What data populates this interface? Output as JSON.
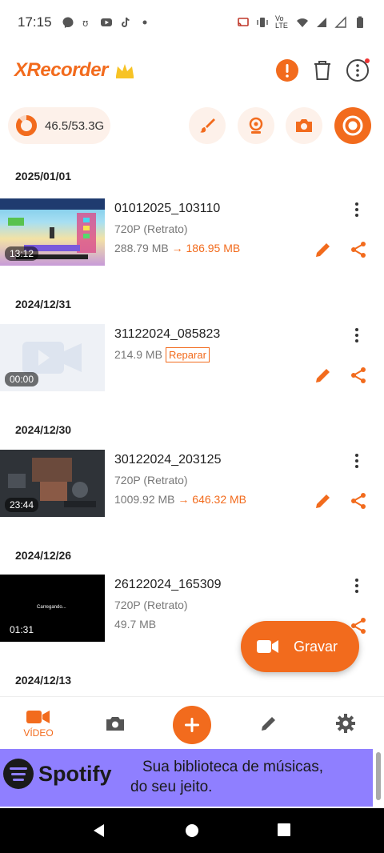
{
  "status": {
    "time": "17:15",
    "volte": "Vo LTE"
  },
  "app": {
    "name": "XRecorder"
  },
  "storage": {
    "text": "46.5/53.3G",
    "used_fraction": 0.87
  },
  "recordings": [
    {
      "date": "2025/01/01",
      "title": "01012025_103110",
      "resolution": "720P (Retrato)",
      "size": "288.79 MB",
      "arrow": "→",
      "compressed": "186.95 MB",
      "duration": "13:12",
      "repair": ""
    },
    {
      "date": "2024/12/31",
      "title": "31122024_085823",
      "resolution": "",
      "size": "214.9 MB",
      "arrow": "",
      "compressed": "",
      "duration": "00:00",
      "repair": "Reparar"
    },
    {
      "date": "2024/12/30",
      "title": "30122024_203125",
      "resolution": "720P (Retrato)",
      "size": "1009.92 MB",
      "arrow": "→",
      "compressed": "646.32 MB",
      "duration": "23:44",
      "repair": ""
    },
    {
      "date": "2024/12/26",
      "title": "26122024_165309",
      "resolution": "720P (Retrato)",
      "size": "49.7 MB",
      "arrow": "",
      "compressed": "",
      "duration": "01:31",
      "repair": "",
      "thumb_text": "Carregando..."
    }
  ],
  "next_date": "2024/12/13",
  "fab": {
    "label": "Gravar"
  },
  "bottom_nav": {
    "video_label": "VÍDEO"
  },
  "ad": {
    "brand": "Spotify",
    "line1": "Sua biblioteca de músicas,",
    "line2": "do seu jeito."
  },
  "colors": {
    "accent": "#f26b1d",
    "ad_bg": "#8f7fff"
  }
}
